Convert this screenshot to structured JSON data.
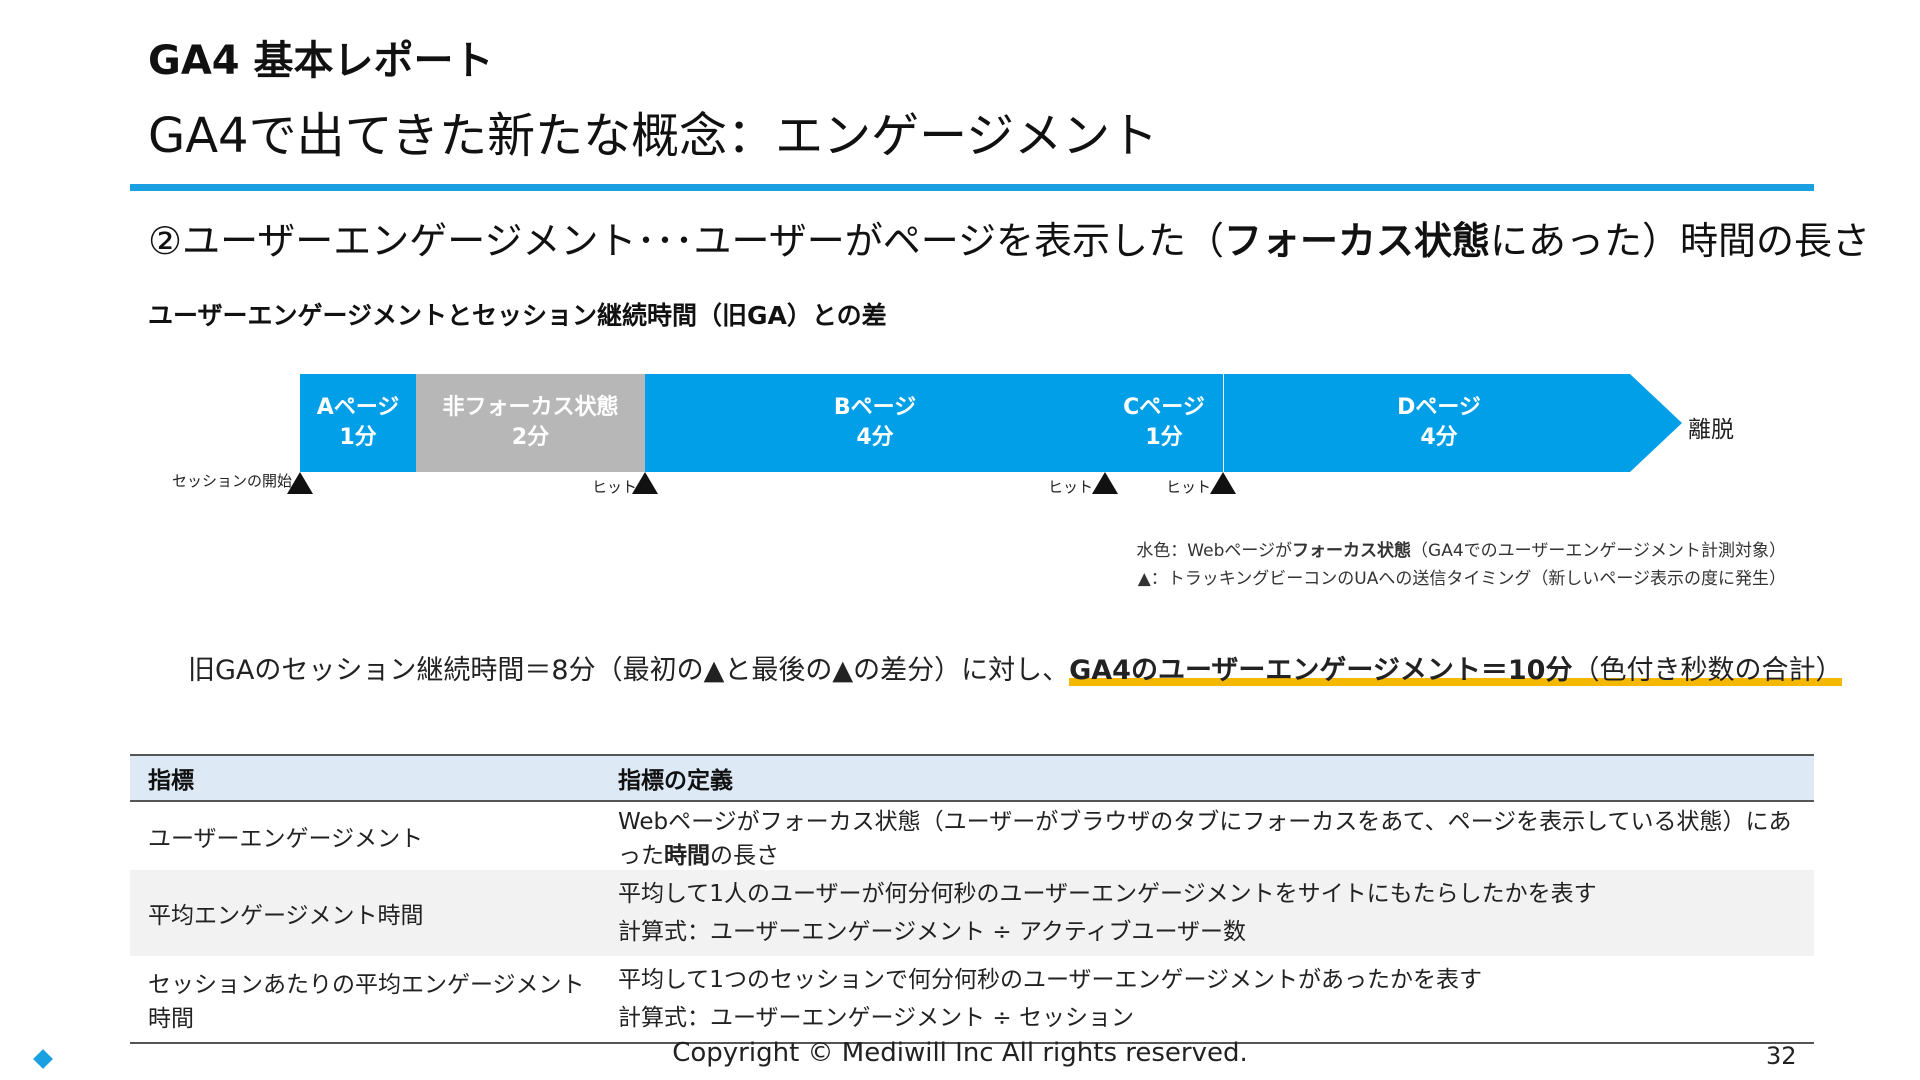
{
  "header": {
    "category": "GA4 基本レポート",
    "title": "GA4で出てきた新たな概念：エンゲージメント"
  },
  "subheading": {
    "prefix": "②ユーザーエンゲージメント･･･ユーザーがページを表示した（",
    "bold": "フォーカス状態",
    "suffix": "にあった）時間の長さ"
  },
  "section_title": "ユーザーエンゲージメントとセッション継続時間（旧GA）との差",
  "timeline": {
    "segments": [
      {
        "name": "Aページ",
        "duration": "1分",
        "color": "#009fe8"
      },
      {
        "name": "非フォーカス状態",
        "duration": "2分",
        "color": "#b7b7b7"
      },
      {
        "name": "Bページ",
        "duration": "4分",
        "color": "#009fe8"
      },
      {
        "name": "Cページ",
        "duration": "1分",
        "color": "#009fe8"
      },
      {
        "name": "Dページ",
        "duration": "4分",
        "color": "#009fe8"
      }
    ],
    "exit_label": "離脱",
    "markers": {
      "session_start": "セッションの開始",
      "hit1": "ヒット",
      "hit2": "ヒット",
      "hit3": "ヒット"
    }
  },
  "legend": {
    "line1_prefix": "水色：Webページが",
    "line1_bold": "フォーカス状態",
    "line1_suffix": "（GA4でのユーザーエンゲージメント計測対象）",
    "line2": "▲：トラッキングビーコンのUAへの送信タイミング（新しいページ表示の度に発生）"
  },
  "summary": {
    "plain": "旧GAのセッション継続時間＝8分（最初の▲と最後の▲の差分）に対し、",
    "highlight_bold": "GA4のユーザーエンゲージメント＝10分",
    "highlight_plain": "（色付き秒数の合計）"
  },
  "table": {
    "headers": [
      "指標",
      "指標の定義"
    ],
    "rows": [
      {
        "metric": "ユーザーエンゲージメント",
        "def_prefix": "Webページがフォーカス状態（ユーザーがブラウザのタブにフォーカスをあて、ページを表示している状態）にあった",
        "def_bold": "時間",
        "def_suffix": "の長さ"
      },
      {
        "metric": "平均エンゲージメント時間",
        "def_line1": "平均して1人のユーザーが何分何秒のユーザーエンゲージメントをサイトにもたらしたかを表す",
        "def_line2": "計算式：ユーザーエンゲージメント ÷ アクティブユーザー数"
      },
      {
        "metric": "セッションあたりの平均エンゲージメント時間",
        "def_line1": "平均して1つのセッションで何分何秒のユーザーエンゲージメントがあったかを表す",
        "def_line2": "計算式：ユーザーエンゲージメント ÷ セッション"
      }
    ]
  },
  "footer": {
    "copyright": "Copyright © Mediwill Inc All rights reserved.",
    "page_number": "32"
  }
}
